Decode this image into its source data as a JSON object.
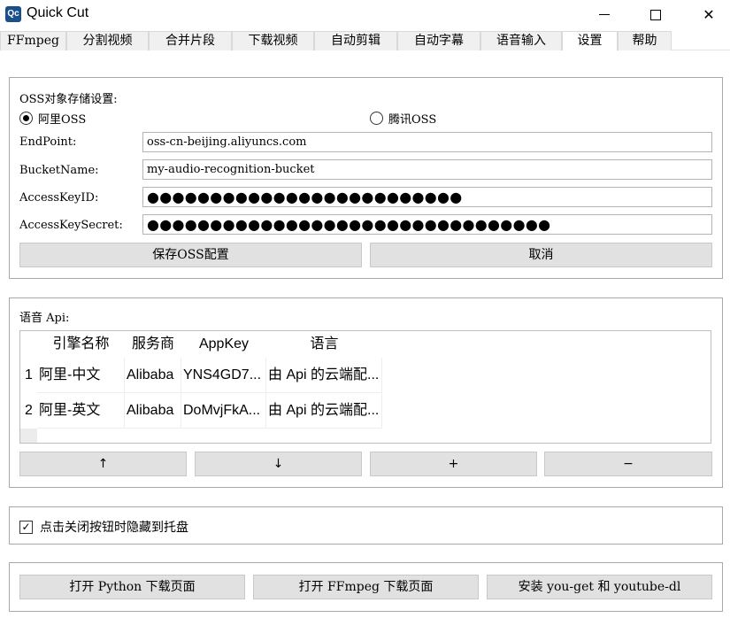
{
  "window": {
    "icon_text": "Qc",
    "title": "Quick Cut",
    "minimize_glyph": "",
    "maximize_glyph": "",
    "close_glyph": "✕"
  },
  "tabs": [
    "FFmpeg",
    "分割视频",
    "合并片段",
    "下载视频",
    "自动剪辑",
    "自动字幕",
    "语音输入",
    "设置",
    "帮助"
  ],
  "active_tab": "设置",
  "oss": {
    "group_title": "OSS对象存储设置:",
    "providers": [
      {
        "label": "阿里OSS",
        "checked": true
      },
      {
        "label": "腾讯OSS",
        "checked": false
      }
    ],
    "endpoint_label": "EndPoint:",
    "endpoint_value": "oss-cn-beijing.aliyuncs.com",
    "bucket_label": "BucketName:",
    "bucket_value": "my-audio-recognition-bucket",
    "keyid_label": "AccessKeyID:",
    "keyid_mask": "●●●●●●●●●●●●●●●●●●●●●●●●●",
    "secret_label": "AccessKeySecret:",
    "secret_mask": "●●●●●●●●●●●●●●●●●●●●●●●●●●●●●●●●",
    "save_button": "保存OSS配置",
    "cancel_button": "取消"
  },
  "api": {
    "group_title": "语音 Api:",
    "columns": [
      "引擎名称",
      "服务商",
      "AppKey",
      "语言"
    ],
    "rows": [
      {
        "index": "1",
        "cells": [
          "阿里-中文",
          "Alibaba",
          "YNS4GD7...",
          "由 Api 的云端配..."
        ]
      },
      {
        "index": "2",
        "cells": [
          "阿里-英文",
          "Alibaba",
          "DoMvjFkA...",
          "由 Api 的云端配..."
        ]
      }
    ],
    "buttons": {
      "up": "↑",
      "down": "↓",
      "add": "+",
      "remove": "−"
    }
  },
  "tray": {
    "checkbox_label": "点击关闭按钮时隐藏到托盘",
    "checked": true,
    "check_glyph": "✓"
  },
  "downloads": {
    "python_button": "打开 Python 下载页面",
    "ffmpeg_button": "打开 FFmpeg 下载页面",
    "install_button": "安装 you-get 和 youtube-dl"
  }
}
